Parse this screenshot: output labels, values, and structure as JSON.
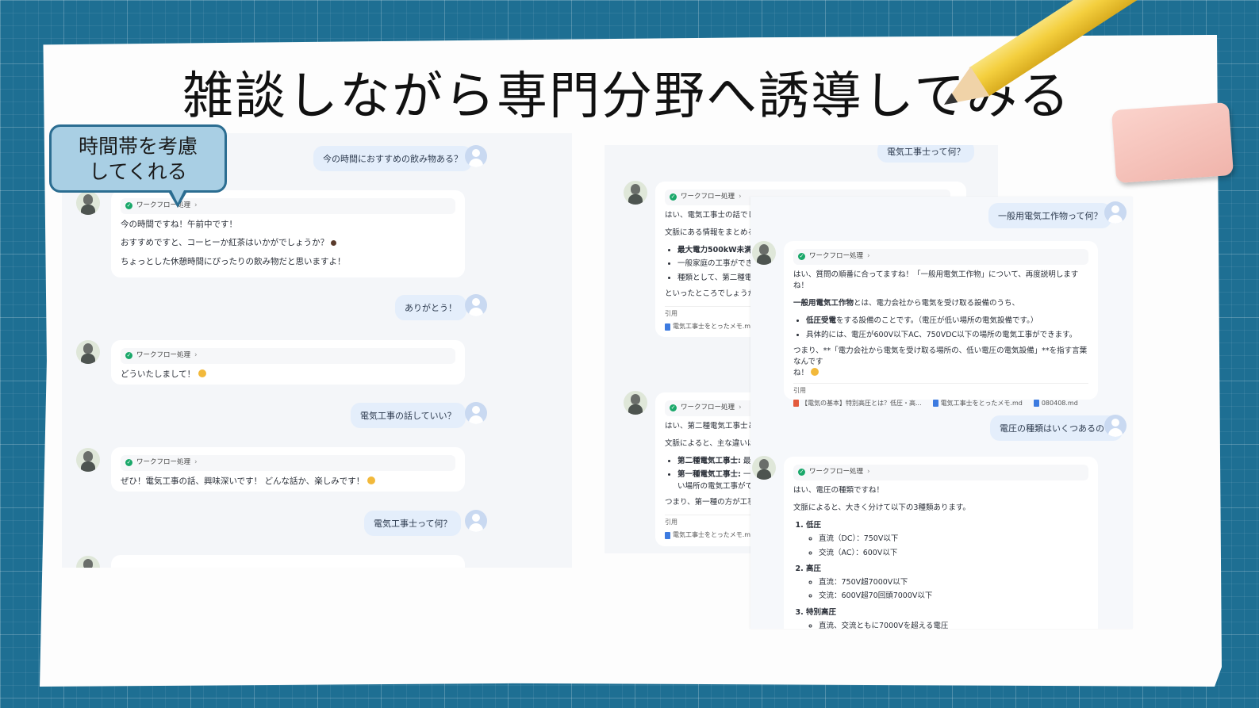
{
  "title": "雑談しながら専門分野へ誘導してみる",
  "callout": {
    "line1": "時間帯を考慮",
    "line2": "してくれる"
  },
  "workflow_label": "ワークフロー処理",
  "left_chat": {
    "q1": "今の時間におすすめの飲み物ある？",
    "a1": {
      "p1": "今の時間ですね！午前中です！",
      "p2": "おすすめですと、コーヒーか紅茶はいかがでしょうか？",
      "p3": "ちょっとした休憩時間にぴったりの飲み物だと思いますよ！"
    },
    "q2": "ありがとう！",
    "a2": "どういたしまして！",
    "q3": "電気工事の話していい？",
    "a3": "ぜひ！電気工事の話、興味深いです！ どんな話か、楽しみです！",
    "q4": "電気工事士って何？"
  },
  "right_back": {
    "q_top": "電気工事士って何？",
    "a1": {
      "p1": "はい、電気工事士の話でした",
      "p2": "文脈にある情報をまとめると、",
      "b1": "最大電力500kW未満の",
      "b2": "一般家庭の工事ができ",
      "b3": "種類として、第二種電気",
      "p3": "といったところでしょうか。",
      "ref_label": "引用",
      "ref1": "電気工事士をとったメモ.md"
    },
    "a2": {
      "p1": "はい、第二種電気工事士と第",
      "p2": "文脈によると、主な違いは以",
      "b1_label": "第二種電気工事士:",
      "b1_rest": " 最",
      "b2_label": "第一種電気工事士:",
      "b2_rest": " 一",
      "b2_cont": "い場所の電気工事ができ",
      "p3": "つまり、第一種の方が工事で",
      "ref_label": "引用",
      "ref1": "電気工事士をとったメモ.md"
    }
  },
  "right_front": {
    "q1": "一般用電気工作物って何？",
    "a1": {
      "p1": "はい、質問の順番に合ってますね！「一般用電気工作物」について、再度説明しますね！",
      "p2_bold": "一般用電気工作物",
      "p2_rest": "とは、電力会社から電気を受け取る設備のうち、",
      "b1_bold": "低圧受電",
      "b1_rest": "をする設備のことです。（電圧が低い場所の電気設備です。）",
      "b2": "具体的には、電圧が600V以下AC、750VDC以下の場所の電気工事ができます。",
      "p3": "つまり、**「電力会社から電気を受け取る場所の、低い電圧の電気設備」**を指す言葉なんです",
      "p3b": "ね！",
      "ref_label": "引用",
      "ref1": "【電気の基本】特別高圧とは？低圧・高...",
      "ref2": "電気工事士をとったメモ.md",
      "ref3": "080408.md"
    },
    "q2": "電圧の種類はいくつあるの？",
    "a2": {
      "p1": "はい、電圧の種類ですね！",
      "p2": "文脈によると、大きく分けて以下の3種類あります。",
      "items": [
        {
          "label": "低圧",
          "subs": [
            "直流（DC）：750V以下",
            "交流（AC）：600V以下"
          ]
        },
        {
          "label": "高圧",
          "subs": [
            "直流：750V超7000V以下",
            "交流：600V超70回頭7000V以下"
          ]
        },
        {
          "label": "特別高圧",
          "subs": [
            "直流、交流ともに7000Vを超える電圧"
          ]
        }
      ]
    }
  },
  "colors": {
    "background": "#1e6f93",
    "callout_fill": "#a9cfe4",
    "callout_border": "#2b6d91",
    "user_bubble": "#e4eefb",
    "check": "#1aa86a"
  },
  "icons": [
    "user-avatar-icon",
    "bot-avatar-icon",
    "check-icon",
    "chevron-right-icon",
    "document-icon",
    "coffee-emoji-icon",
    "smile-emoji-icon",
    "pencil-icon",
    "eraser-icon"
  ]
}
